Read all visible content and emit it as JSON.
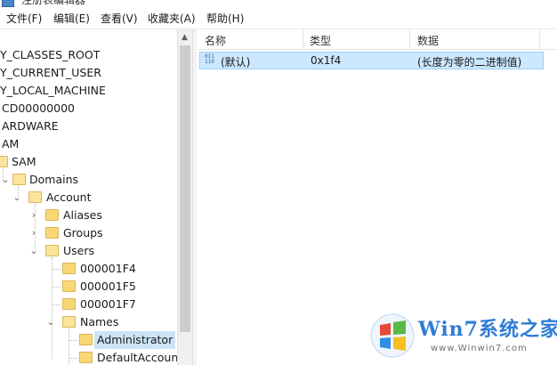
{
  "window": {
    "title": "注册表编辑器"
  },
  "menu": [
    "文件(F)",
    "编辑(E)",
    "查看(V)",
    "收藏夹(A)",
    "帮助(H)"
  ],
  "tree": {
    "items": [
      "Y_CLASSES_ROOT",
      "Y_CURRENT_USER",
      "Y_LOCAL_MACHINE",
      "CD00000000",
      "ARDWARE",
      "AM",
      "SAM",
      "Domains",
      "Account",
      "Aliases",
      "Groups",
      "Users",
      "000001F4",
      "000001F5",
      "000001F7",
      "Names",
      "Administrator",
      "DefaultAccount"
    ],
    "selected": "Administrator"
  },
  "list": {
    "columns": [
      "名称",
      "类型",
      "数据"
    ],
    "rows": [
      {
        "name": "(默认)",
        "type": "0x1f4",
        "data": "(长度为零的二进制值)"
      }
    ]
  },
  "watermark": {
    "text": "Win7系统之家",
    "url": "www.Winwin7.com"
  },
  "colors": {
    "selection": "#cce4f7",
    "folder": "#f8d775",
    "accent": "#2e7bd6"
  }
}
